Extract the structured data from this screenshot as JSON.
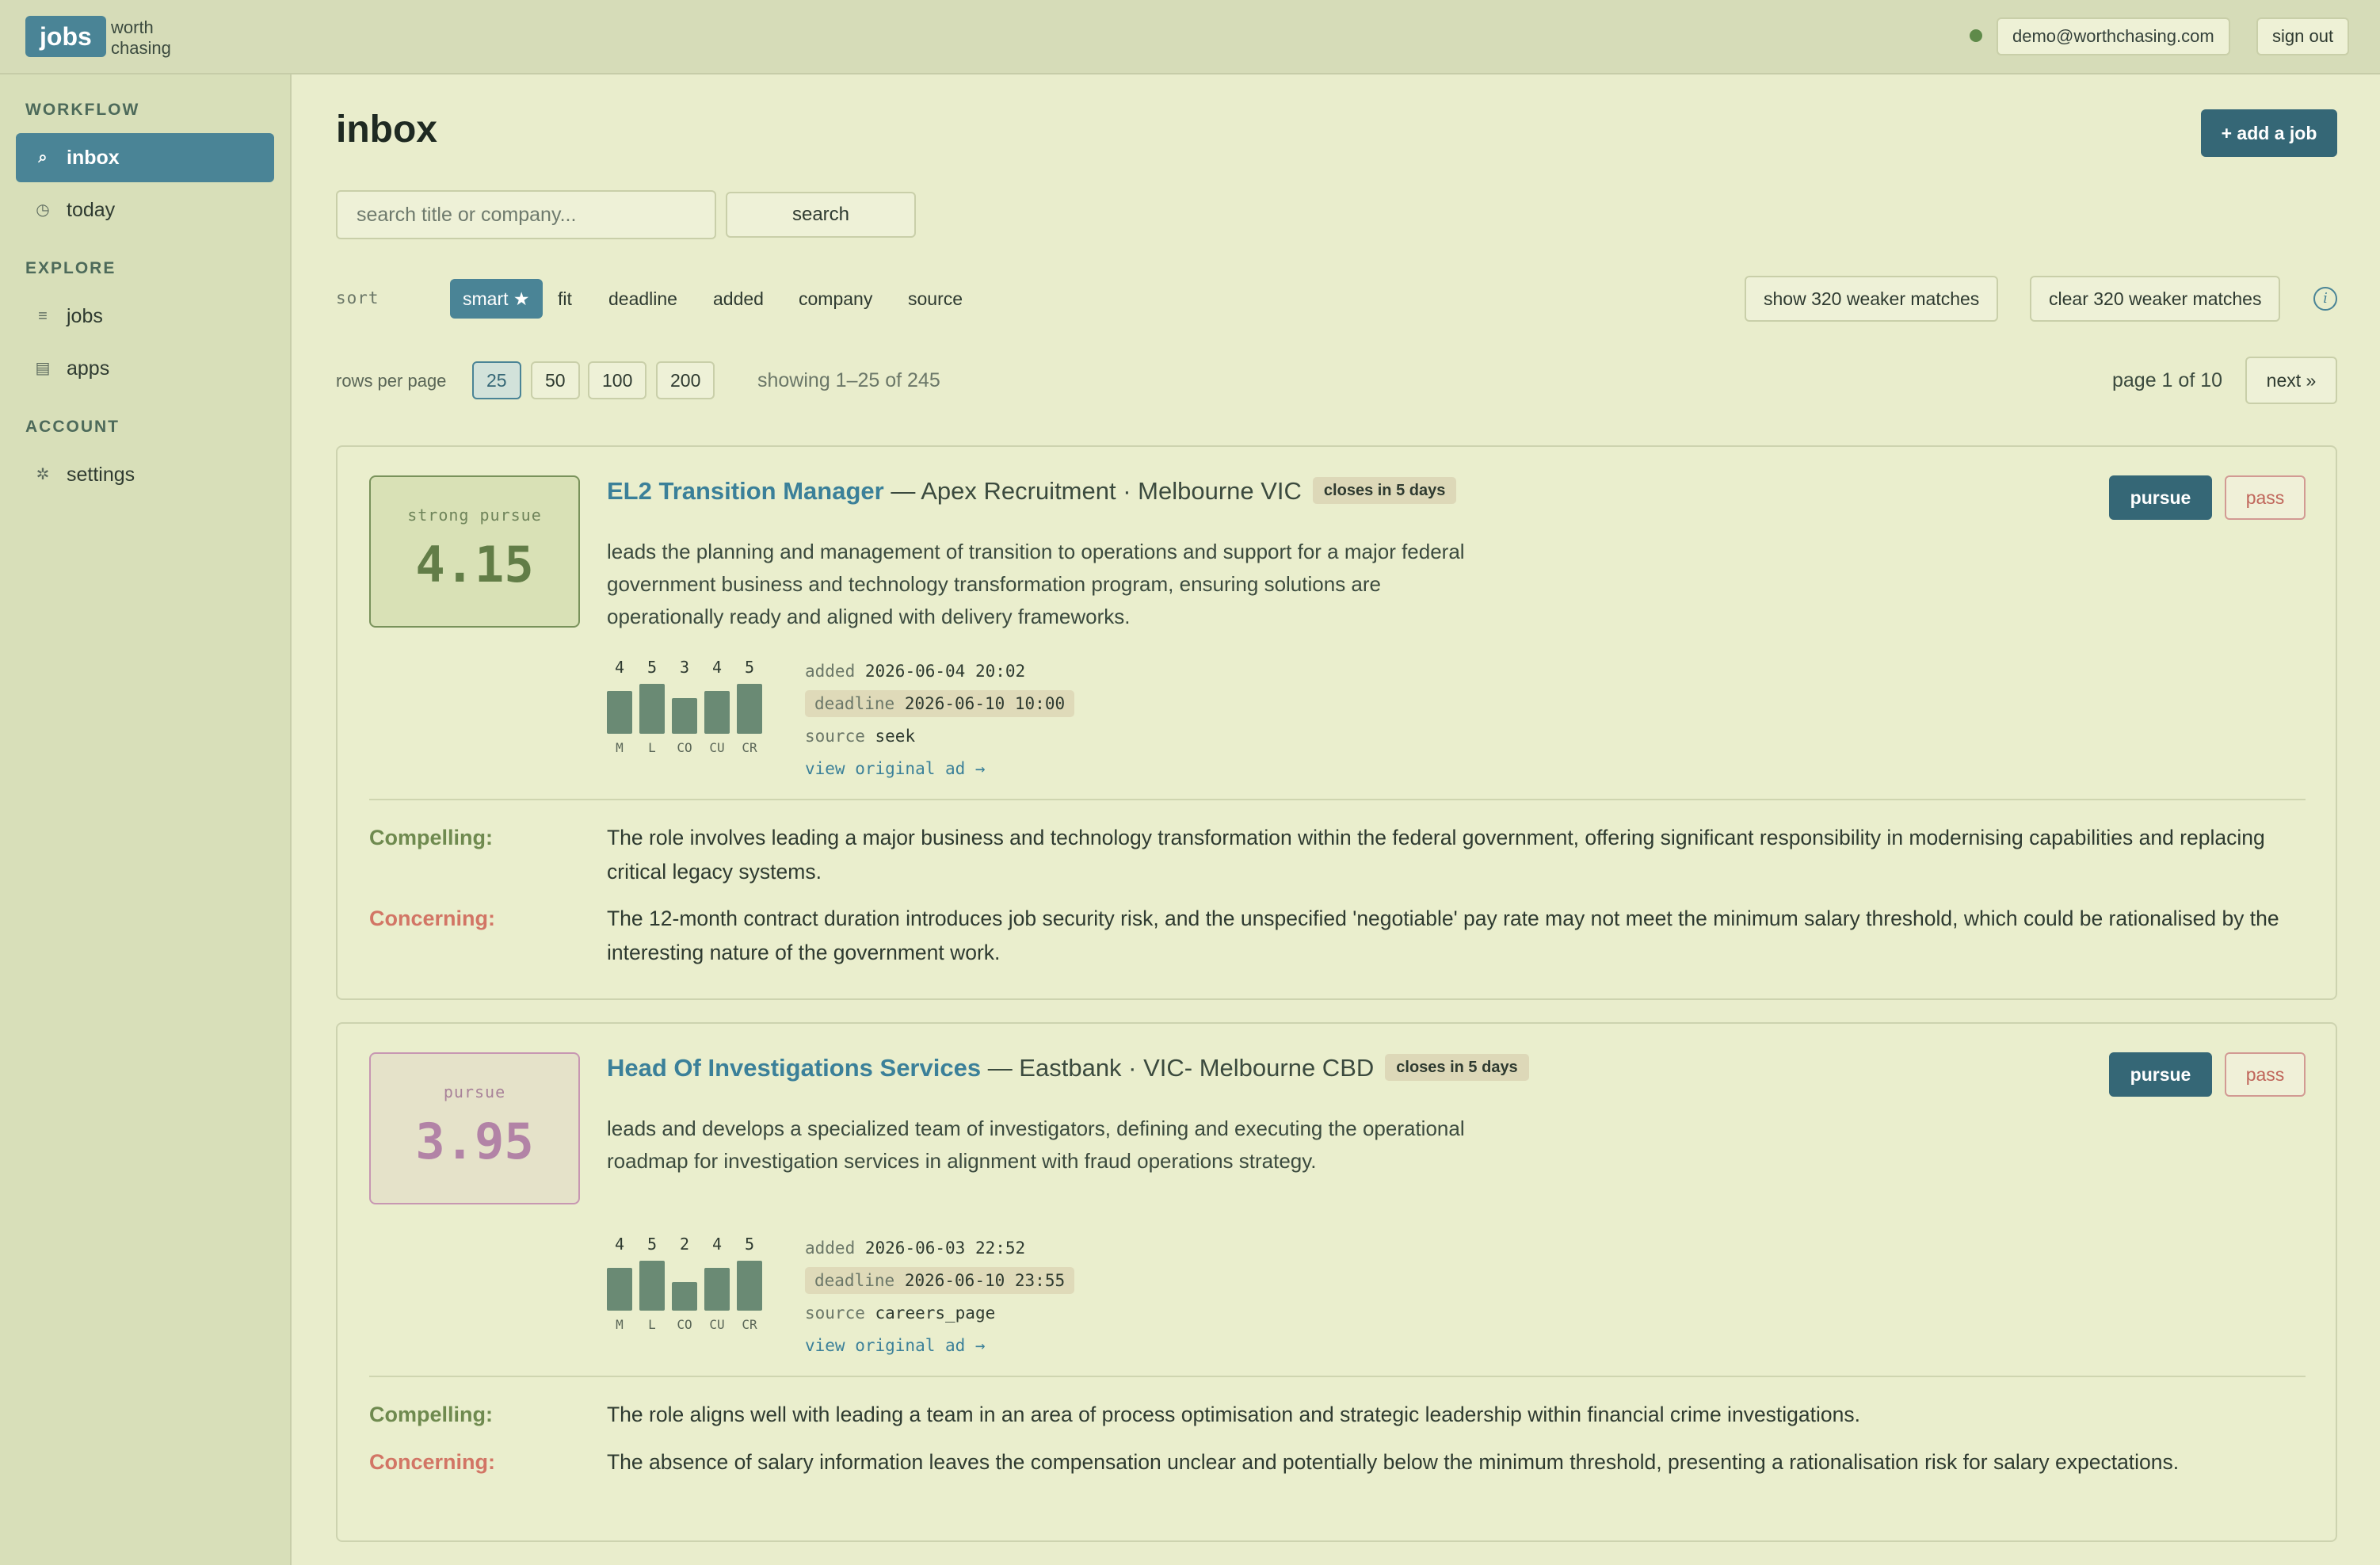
{
  "brand": {
    "badge": "jobs",
    "line1": "worth",
    "line2": "chasing"
  },
  "user": {
    "email": "demo@worthchasing.com",
    "sign_out": "sign out"
  },
  "sidebar": {
    "sections": [
      {
        "heading": "WORKFLOW",
        "items": [
          {
            "label": "inbox",
            "icon": "search-icon",
            "active": true
          },
          {
            "label": "today",
            "icon": "clock-icon"
          }
        ]
      },
      {
        "heading": "EXPLORE",
        "items": [
          {
            "label": "jobs",
            "icon": "list-icon"
          },
          {
            "label": "apps",
            "icon": "table-icon"
          }
        ]
      },
      {
        "heading": "ACCOUNT",
        "items": [
          {
            "label": "settings",
            "icon": "gear-icon"
          }
        ]
      }
    ]
  },
  "page": {
    "title": "inbox",
    "add_job": "+ add a job"
  },
  "search": {
    "placeholder": "search title or company...",
    "button": "search"
  },
  "sort": {
    "label": "sort",
    "options": [
      "smart ★",
      "fit",
      "deadline",
      "added",
      "company",
      "source"
    ],
    "active": "smart ★",
    "show_weaker": "show 320 weaker matches",
    "clear_weaker": "clear 320 weaker matches",
    "info_icon": "info-icon"
  },
  "pagination": {
    "rows_label": "rows per page",
    "rows_options": [
      "25",
      "50",
      "100",
      "200"
    ],
    "rows_active": "25",
    "showing": "showing 1–25 of 245",
    "page_info": "page 1 of 10",
    "next": "next »"
  },
  "jobs": [
    {
      "score_label": "strong pursue",
      "score": "4.15",
      "title": "EL2 Transition Manager",
      "meta": " — Apex Recruitment · Melbourne VIC",
      "closes": "closes in 5 days",
      "description": "leads the planning and management of transition to operations and support for a major federal government business and technology transformation program, ensuring solutions are operationally ready and aligned with delivery frameworks.",
      "criteria": [
        {
          "key": "M",
          "value": 4
        },
        {
          "key": "L",
          "value": 5
        },
        {
          "key": "CO",
          "value": 3
        },
        {
          "key": "CU",
          "value": 4
        },
        {
          "key": "CR",
          "value": 5
        }
      ],
      "added_key": "added",
      "added": "2026-06-04 20:02",
      "deadline_key": "deadline",
      "deadline": "2026-06-10 10:00",
      "source_key": "source",
      "source": "seek",
      "view_link": "view original ad →",
      "compelling_label": "Compelling:",
      "compelling": "The role involves leading a major business and technology transformation within the federal government, offering significant responsibility in modernising capabilities and replacing critical legacy systems.",
      "concerning_label": "Concerning:",
      "concerning": "The 12-month contract duration introduces job security risk, and the unspecified 'negotiable' pay rate may not meet the minimum salary threshold, which could be rationalised by the interesting nature of the government work.",
      "pursue": "pursue",
      "pass": "pass"
    },
    {
      "score_label": "pursue",
      "score": "3.95",
      "title": "Head Of Investigations Services",
      "meta": " — Eastbank · VIC- Melbourne CBD",
      "closes": "closes in 5 days",
      "description": "leads and develops a specialized team of investigators, defining and executing the operational roadmap for investigation services in alignment with fraud operations strategy.",
      "criteria": [
        {
          "key": "M",
          "value": 4
        },
        {
          "key": "L",
          "value": 5
        },
        {
          "key": "CO",
          "value": 2
        },
        {
          "key": "CU",
          "value": 4
        },
        {
          "key": "CR",
          "value": 5
        }
      ],
      "added_key": "added",
      "added": "2026-06-03 22:52",
      "deadline_key": "deadline",
      "deadline": "2026-06-10 23:55",
      "source_key": "source",
      "source": "careers_page",
      "view_link": "view original ad →",
      "compelling_label": "Compelling:",
      "compelling": "The role aligns well with leading a team in an area of process optimisation and strategic leadership within financial crime investigations.",
      "concerning_label": "Concerning:",
      "concerning": "The absence of salary information leaves the compensation unclear and potentially below the minimum threshold, presenting a rationalisation risk for salary expectations.",
      "pursue": "pursue",
      "pass": "pass"
    }
  ],
  "colors": {
    "accent": "#4a8496",
    "primary_button": "#356776",
    "background": "#e9edcc",
    "sidebar": "#d8dfb9",
    "bar": "#6a8a74"
  }
}
